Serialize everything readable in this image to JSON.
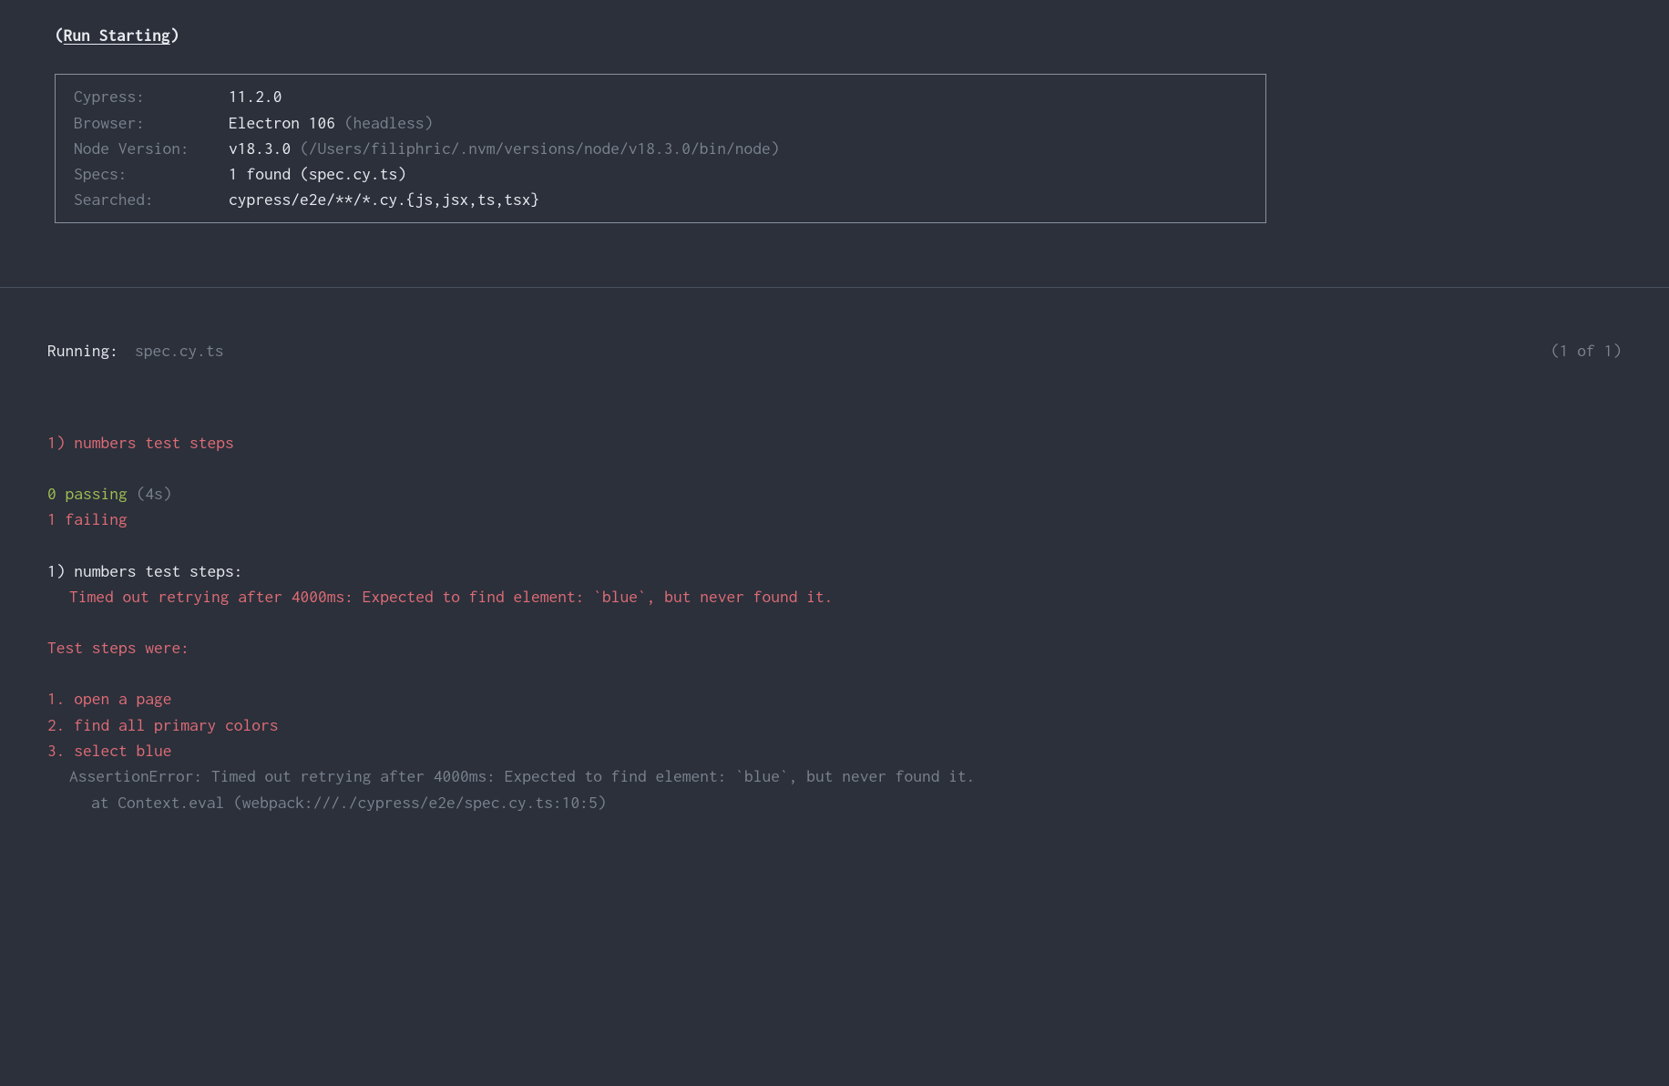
{
  "header": {
    "paren_open": "(",
    "title": "Run Starting",
    "paren_close": ")"
  },
  "info": {
    "cypress": {
      "label": "Cypress:",
      "value": "11.2.0"
    },
    "browser": {
      "label": "Browser:",
      "value": "Electron 106 ",
      "extra": "(headless)"
    },
    "node": {
      "label": "Node Version:",
      "value": "v18.3.0 ",
      "extra": "(/Users/filiphric/.nvm/versions/node/v18.3.0/bin/node)"
    },
    "specs": {
      "label": "Specs:",
      "value": "1 found (spec.cy.ts)"
    },
    "searched": {
      "label": "Searched:",
      "value": "cypress/e2e/**/*.cy.{js,jsx,ts,tsx}"
    }
  },
  "running": {
    "label": "Running:",
    "spec": "spec.cy.ts",
    "count": "(1 of 1)"
  },
  "results": {
    "test_name": "1) numbers test steps",
    "passing_count": "0",
    "passing_label": " passing ",
    "passing_time": "(4s)",
    "failing": "1 failing",
    "failure_title": "1) numbers test steps:",
    "failure_msg": "Timed out retrying after 4000ms: Expected to find element: `blue`, but never found it.",
    "steps_label": "Test steps were:",
    "step1": "1. open a page",
    "step2": "2. find all primary colors",
    "step3": "3. select blue",
    "assertion_error": "AssertionError: Timed out retrying after 4000ms: Expected to find element: `blue`, but never found it.",
    "stack_trace": "at Context.eval (webpack:///./cypress/e2e/spec.cy.ts:10:5)"
  }
}
